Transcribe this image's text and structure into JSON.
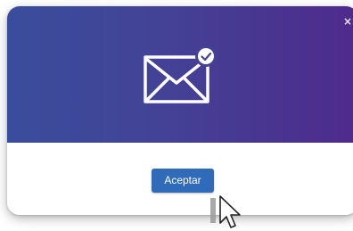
{
  "dialog": {
    "close_glyph": "×",
    "header_gradient": [
      "#3a4d9c",
      "#4e2a8c"
    ],
    "icon": "envelope-check-icon",
    "accept_label": "Aceptar",
    "accept_color": "#2f6bb8"
  },
  "cursor": {
    "icon": "mouse-pointer-icon"
  }
}
